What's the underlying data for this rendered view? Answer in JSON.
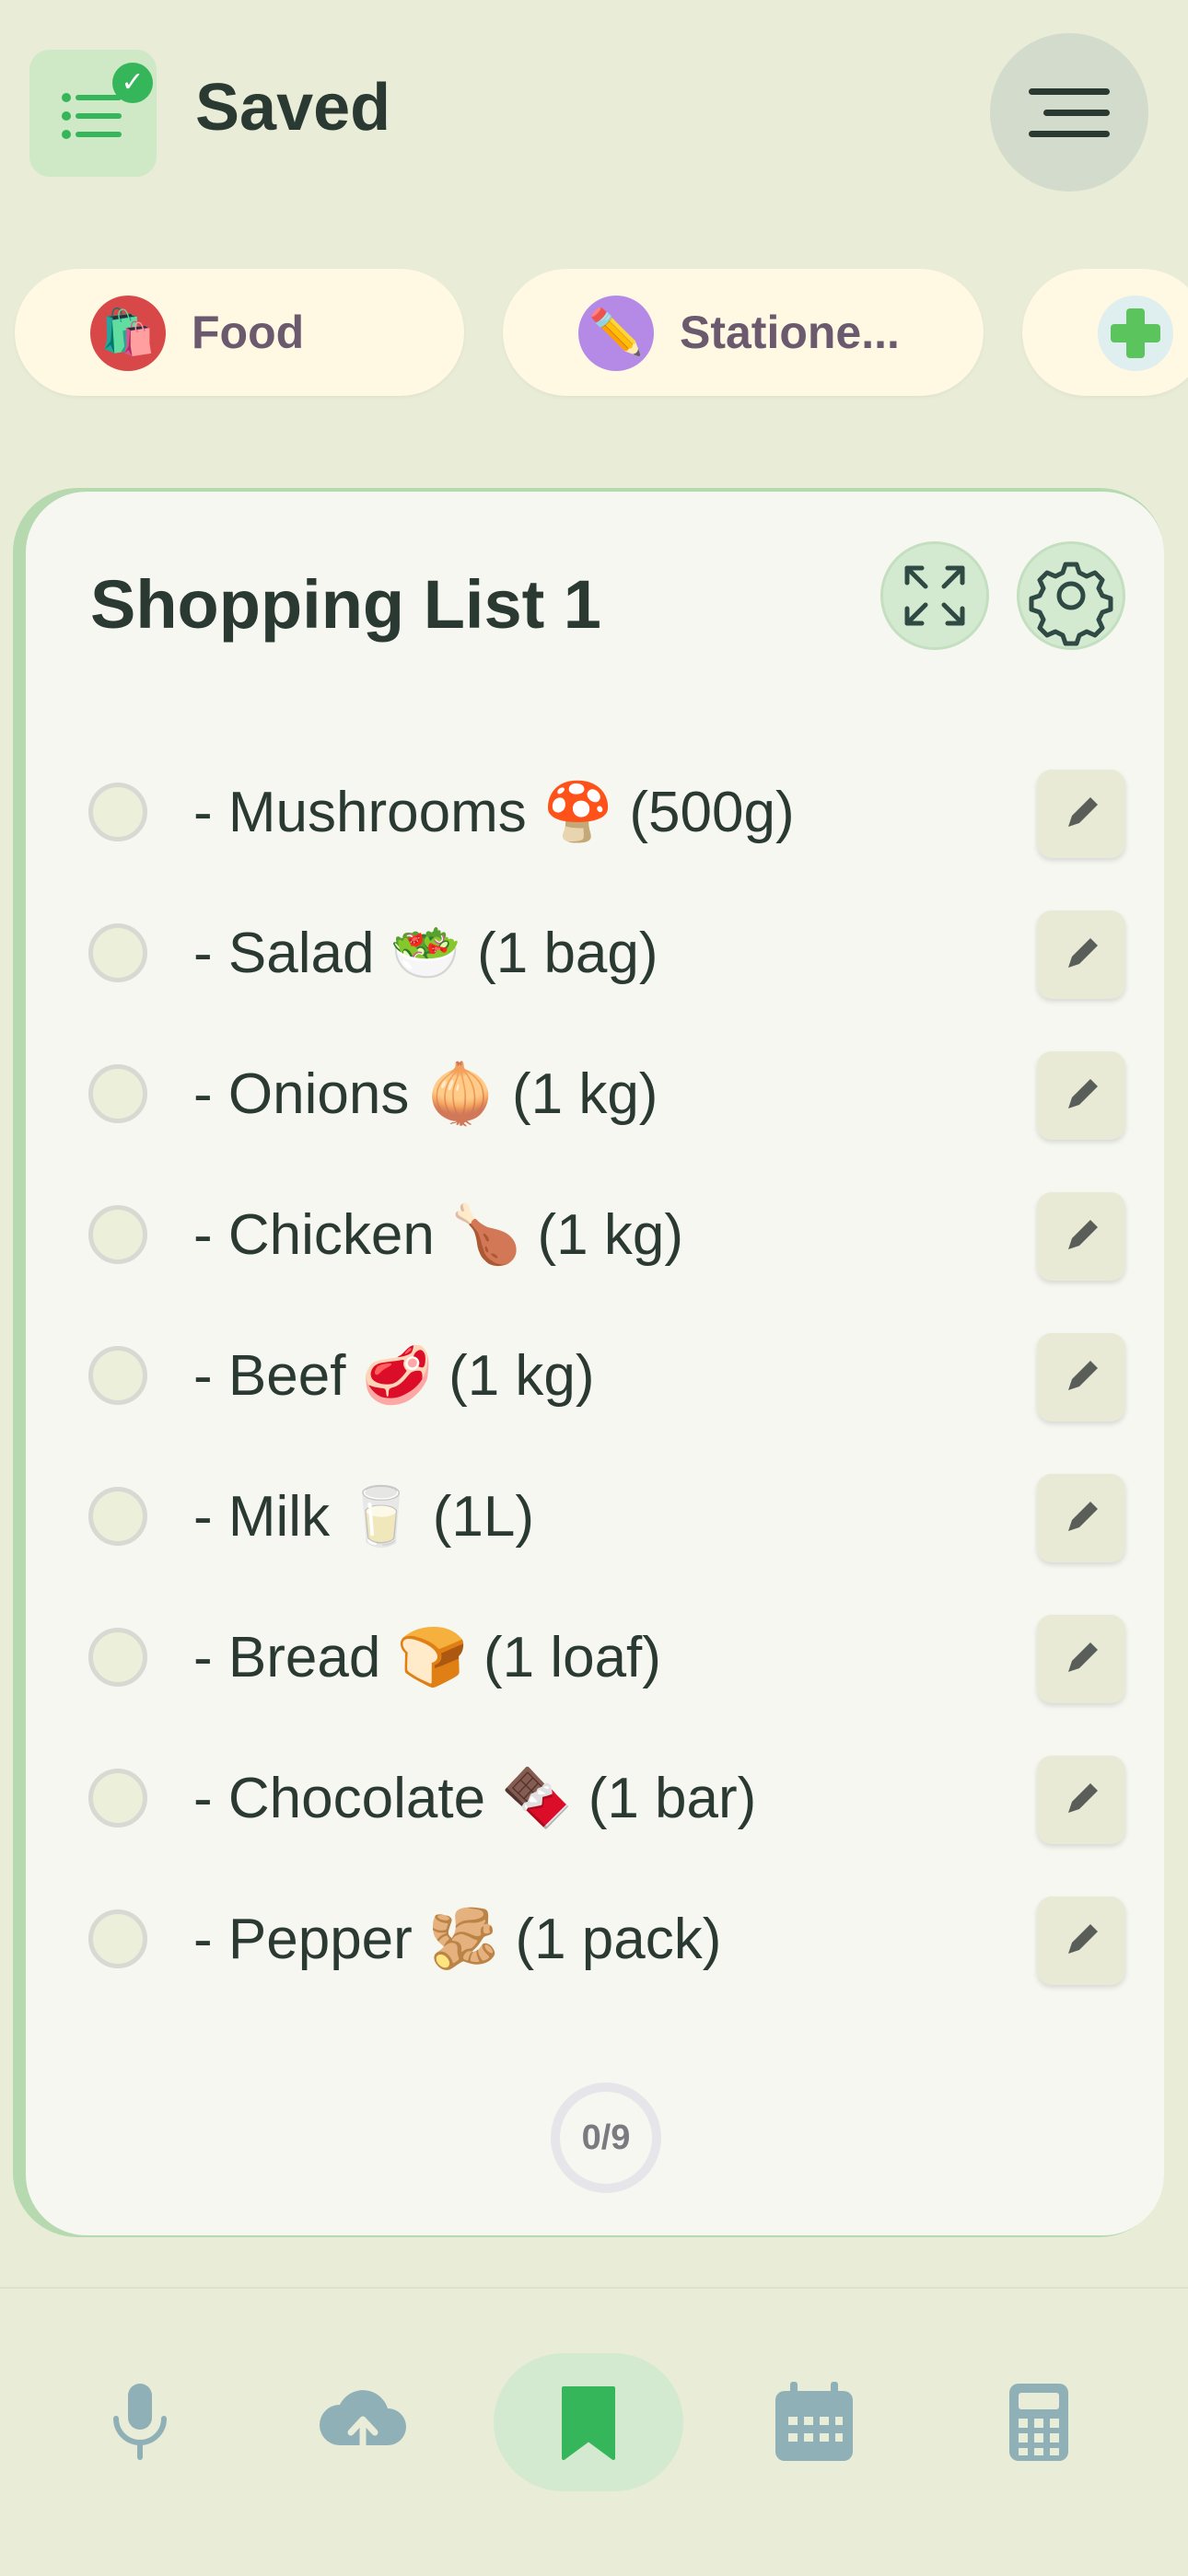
{
  "header": {
    "title": "Saved",
    "app_icon": "list-check-icon",
    "menu_icon": "hamburger-menu-icon"
  },
  "categories": [
    {
      "label": "Food",
      "icon": "grocery-bag-icon",
      "emoji": "🛍️",
      "icon_bg": "#d94848"
    },
    {
      "label": "Statione...",
      "icon": "pencil-icon",
      "emoji": "✏️",
      "icon_bg": "#b58ae6"
    },
    {
      "label": "",
      "icon": "add-icon",
      "emoji": "",
      "icon_bg": "#dfeeee"
    }
  ],
  "list": {
    "title": "Shopping List 1",
    "expand_icon": "expand-icon",
    "settings_icon": "gear-icon",
    "items": [
      {
        "text": "- Mushrooms 🍄 (500g)",
        "checked": false
      },
      {
        "text": "- Salad 🥗 (1 bag)",
        "checked": false
      },
      {
        "text": "- Onions 🧅 (1 kg)",
        "checked": false
      },
      {
        "text": "- Chicken 🍗 (1 kg)",
        "checked": false
      },
      {
        "text": "- Beef 🥩 (1 kg)",
        "checked": false
      },
      {
        "text": "- Milk 🥛 (1L)",
        "checked": false
      },
      {
        "text": "- Bread 🍞 (1 loaf)",
        "checked": false
      },
      {
        "text": "- Chocolate 🍫 (1 bar)",
        "checked": false
      },
      {
        "text": "- Pepper 🫚 (1 pack)",
        "checked": false
      }
    ],
    "progress": "0/9"
  },
  "bottom_nav": [
    {
      "icon": "microphone-icon",
      "active": false
    },
    {
      "icon": "cloud-upload-icon",
      "active": false
    },
    {
      "icon": "bookmark-icon",
      "active": true
    },
    {
      "icon": "calendar-icon",
      "active": false
    },
    {
      "icon": "calculator-icon",
      "active": false
    }
  ],
  "colors": {
    "background": "#e9ecd6",
    "accent_green": "#35b65a",
    "card": "#f6f7f1",
    "chip": "#fff8e3",
    "text": "#2a3a33",
    "nav_icon": "#8fb0b6"
  }
}
